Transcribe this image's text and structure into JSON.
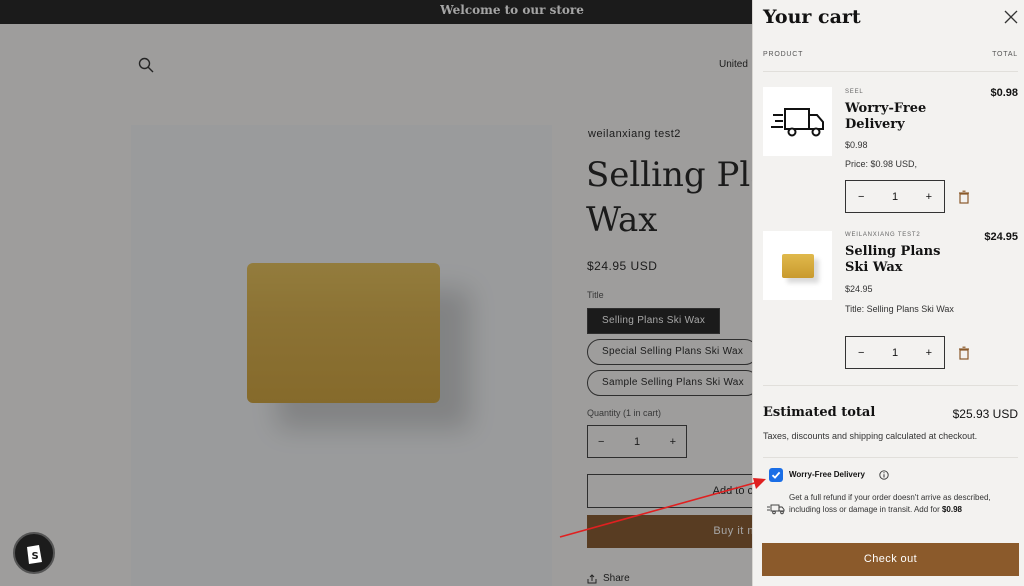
{
  "announcement": "Welcome to our store",
  "header": {
    "country": "United"
  },
  "product": {
    "vendor": "weilanxiang test2",
    "title": "Selling Plans Ski Wax",
    "title_line1": "Selling Pla",
    "title_line2": "Wax",
    "price": "$24.95 USD",
    "option_label": "Title",
    "variants": [
      "Selling Plans Ski Wax",
      "Special Selling Plans Ski Wax",
      "Sample Selling Plans Ski Wax"
    ],
    "quantity_label": "Quantity (1 in cart)",
    "quantity": "1",
    "add_to_cart": "Add to c",
    "buy_now": "Buy it n",
    "share": "Share"
  },
  "cart": {
    "title": "Your cart",
    "col_product": "PRODUCT",
    "col_total": "TOTAL",
    "items": [
      {
        "vendor": "SEEL",
        "name": "Worry-Free Delivery",
        "price": "$0.98",
        "detail": "Price: $0.98 USD,",
        "quantity": "1",
        "total": "$0.98",
        "icon": "delivery-truck-icon"
      },
      {
        "vendor": "WEILANXIANG TEST2",
        "name": "Selling Plans Ski Wax",
        "price": "$24.95",
        "detail": "Title: Selling Plans Ski Wax",
        "quantity": "1",
        "total": "$24.95",
        "icon": "soap-bar-image"
      }
    ],
    "estimated_label": "Estimated total",
    "estimated_value": "$25.93 USD",
    "tax_note": "Taxes, discounts and shipping calculated at checkout.",
    "wfd_title": "Worry-Free Delivery",
    "wfd_desc": "Get a full refund if your order doesn't arrive as described, including loss or damage in transit. Add for",
    "wfd_price": "$0.98",
    "wfd_checked": true,
    "checkout": "Check out"
  },
  "colors": {
    "accent_brown": "#8b5a2b",
    "checkbox_blue": "#1a6ee6",
    "annotation_red": "#e02020"
  }
}
